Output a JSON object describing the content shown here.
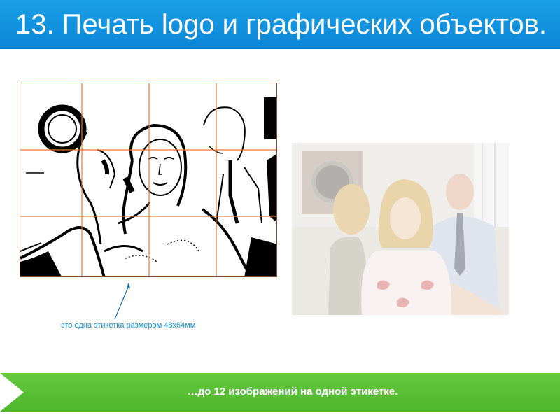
{
  "slide": {
    "title": "13. Печать logo и графических объектов.",
    "caption": "это одна этикетка размером 48х64мм",
    "footer": "…до 12 изображений на одной этикетке."
  },
  "colors": {
    "title_bar": "#0b86d6",
    "footer_bar": "#4db62b",
    "caption_text": "#1a8fd8",
    "grid_lines": "#e07a3c"
  },
  "images": {
    "left": "bw-threshold-photo-with-print-grid",
    "right": "faded-color-photo-woman-in-office"
  }
}
